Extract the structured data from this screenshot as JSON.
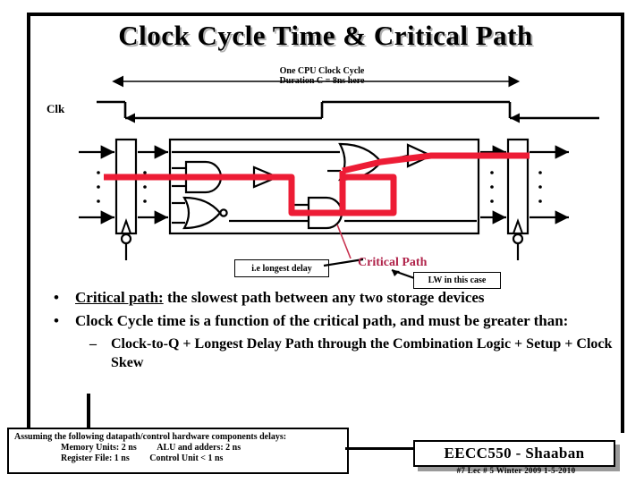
{
  "slide": {
    "title": "Clock Cycle Time & Critical Path",
    "clock_cycle_caption_line1": "One CPU Clock Cycle",
    "clock_cycle_caption_line2": "Duration C = 8ns here",
    "clk_label": "Clk"
  },
  "callouts": {
    "longest_delay": "i.e longest delay",
    "critical_path": "Critical Path",
    "lw_case": "LW in this case",
    "critical_path_color": "#b0234a",
    "path_highlight_color": "#ed1c35"
  },
  "bullets": [
    {
      "marker": "•",
      "lead": "Critical path:",
      "rest": " the slowest path between any two storage devices"
    },
    {
      "marker": "•",
      "lead": "",
      "rest": "Clock Cycle time is a function of the critical path, and must be greater than:"
    }
  ],
  "sub_bullet": {
    "marker": "–",
    "text": "Clock-to-Q + Longest Delay Path through the Combination Logic + Setup + Clock Skew"
  },
  "assumptions": {
    "heading": "Assuming the following datapath/control hardware components delays:",
    "rows": [
      {
        "left": "Memory Units:  2 ns",
        "right": "ALU and adders:  2 ns"
      },
      {
        "left": "Register File:  1 ns",
        "right": "Control Unit  < 1 ns"
      }
    ]
  },
  "footer": {
    "course": "EECC550 - Shaaban",
    "meta": "#7   Lec # 5  Winter 2009  1-5-2010"
  }
}
